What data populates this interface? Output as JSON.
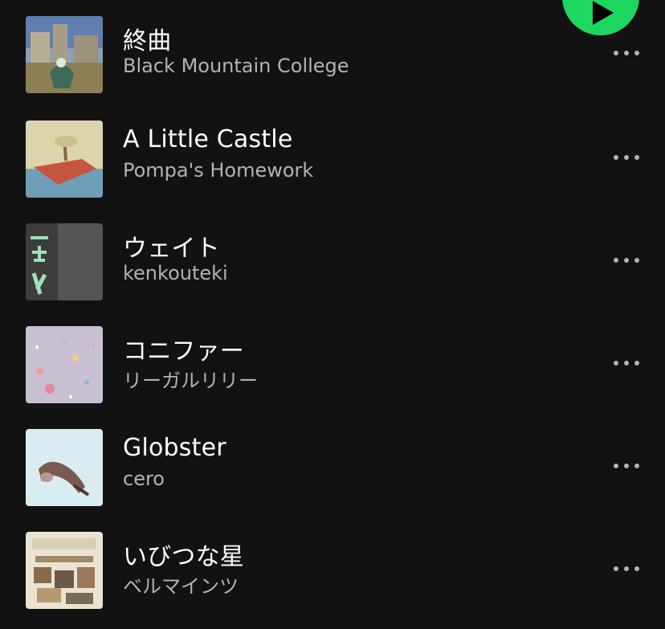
{
  "playlist": {
    "play_button_color": "#1ed760",
    "tracks": [
      {
        "title": "終曲",
        "artist": "Black Mountain College",
        "more_icon": "more-horizontal-icon"
      },
      {
        "title": "A Little Castle",
        "artist": "Pompa's Homework",
        "more_icon": "more-horizontal-icon"
      },
      {
        "title": "ウェイト",
        "artist": "kenkouteki",
        "more_icon": "more-horizontal-icon"
      },
      {
        "title": "コニファー",
        "artist": "リーガルリリー",
        "more_icon": "more-horizontal-icon"
      },
      {
        "title": "Globster",
        "artist": "cero",
        "more_icon": "more-horizontal-icon"
      },
      {
        "title": "いびつな星",
        "artist": "ベルマインツ",
        "more_icon": "more-horizontal-icon"
      }
    ]
  },
  "colors": {
    "background": "#121212",
    "title": "#ffffff",
    "artist": "#b3b3b3",
    "accent": "#1ed760"
  }
}
